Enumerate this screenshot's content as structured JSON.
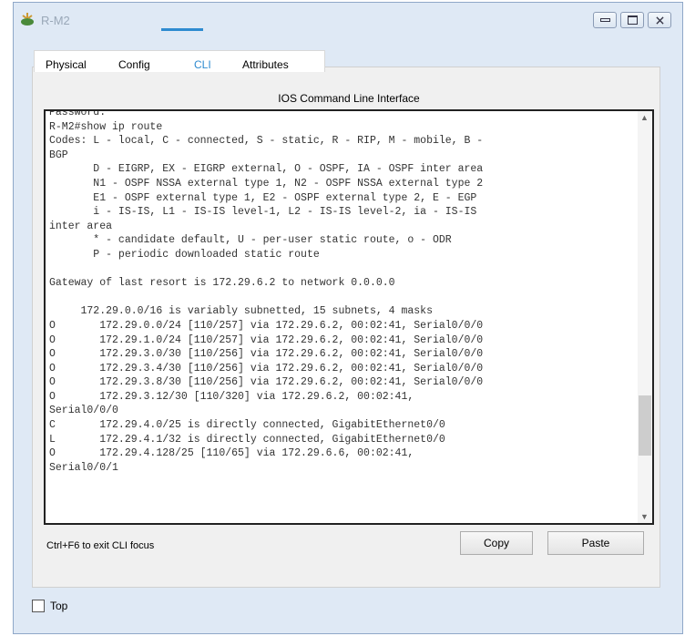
{
  "window": {
    "title": "R-M2",
    "controls": [
      "minimize",
      "maximize",
      "close"
    ]
  },
  "tabs": [
    {
      "label": "Physical"
    },
    {
      "label": "Config"
    },
    {
      "label": "CLI",
      "active": true
    },
    {
      "label": "Attributes"
    }
  ],
  "cli": {
    "title": "IOS Command Line Interface",
    "lines": [
      "Password:",
      "R-M2#show ip route",
      "Codes: L - local, C - connected, S - static, R - RIP, M - mobile, B -",
      "BGP",
      "       D - EIGRP, EX - EIGRP external, O - OSPF, IA - OSPF inter area",
      "       N1 - OSPF NSSA external type 1, N2 - OSPF NSSA external type 2",
      "       E1 - OSPF external type 1, E2 - OSPF external type 2, E - EGP",
      "       i - IS-IS, L1 - IS-IS level-1, L2 - IS-IS level-2, ia - IS-IS",
      "inter area",
      "       * - candidate default, U - per-user static route, o - ODR",
      "       P - periodic downloaded static route",
      "",
      "Gateway of last resort is 172.29.6.2 to network 0.0.0.0",
      "",
      "     172.29.0.0/16 is variably subnetted, 15 subnets, 4 masks",
      "O       172.29.0.0/24 [110/257] via 172.29.6.2, 00:02:41, Serial0/0/0",
      "O       172.29.1.0/24 [110/257] via 172.29.6.2, 00:02:41, Serial0/0/0",
      "O       172.29.3.0/30 [110/256] via 172.29.6.2, 00:02:41, Serial0/0/0",
      "O       172.29.3.4/30 [110/256] via 172.29.6.2, 00:02:41, Serial0/0/0",
      "O       172.29.3.8/30 [110/256] via 172.29.6.2, 00:02:41, Serial0/0/0",
      "O       172.29.3.12/30 [110/320] via 172.29.6.2, 00:02:41,",
      "Serial0/0/0",
      "C       172.29.4.0/25 is directly connected, GigabitEthernet0/0",
      "L       172.29.4.1/32 is directly connected, GigabitEthernet0/0",
      "O       172.29.4.128/25 [110/65] via 172.29.6.6, 00:02:41,",
      "Serial0/0/1"
    ]
  },
  "status_text": "Ctrl+F6 to exit CLI focus",
  "buttons": {
    "copy": "Copy",
    "paste": "Paste"
  },
  "top_checkbox": {
    "label": "Top",
    "checked": false
  },
  "colors": {
    "accent": "#2e8bd0",
    "window_bg": "#dfe9f5"
  }
}
